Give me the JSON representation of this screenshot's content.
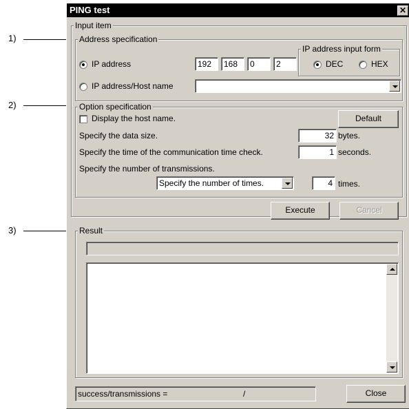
{
  "callouts": [
    "1)",
    "2)",
    "3)"
  ],
  "window": {
    "title": "PING test",
    "close_glyph": "✕"
  },
  "input_item": {
    "legend": "Input item"
  },
  "address_spec": {
    "legend": "Address specification",
    "ip_radio_label": "IP address",
    "ip_octets": [
      "192",
      "168",
      "0",
      "2"
    ],
    "host_radio_label": "IP address/Host name",
    "host_value": "",
    "ip_form": {
      "legend": "IP address input form",
      "dec_label": "DEC",
      "hex_label": "HEX",
      "selected": "DEC"
    },
    "selected": "IP address"
  },
  "option_spec": {
    "legend": "Option specification",
    "display_host_label": "Display the host name.",
    "display_host_checked": false,
    "default_button": "Default",
    "data_size_label": "Specify the data size.",
    "data_size_value": "32",
    "data_size_unit": "bytes.",
    "check_time_label": "Specify the time of the communication time check.",
    "check_time_value": "1",
    "check_time_unit": "seconds.",
    "transmissions_label": "Specify the number of transmissions.",
    "transmissions_mode": "Specify the number of times.",
    "transmissions_value": "4",
    "transmissions_unit": "times."
  },
  "actions": {
    "execute": "Execute",
    "cancel": "Cancel"
  },
  "result": {
    "legend": "Result",
    "status_text": "",
    "log_text": ""
  },
  "footer": {
    "summary_label": "success/transmissions =",
    "summary_separator": "/",
    "close_button": "Close"
  }
}
